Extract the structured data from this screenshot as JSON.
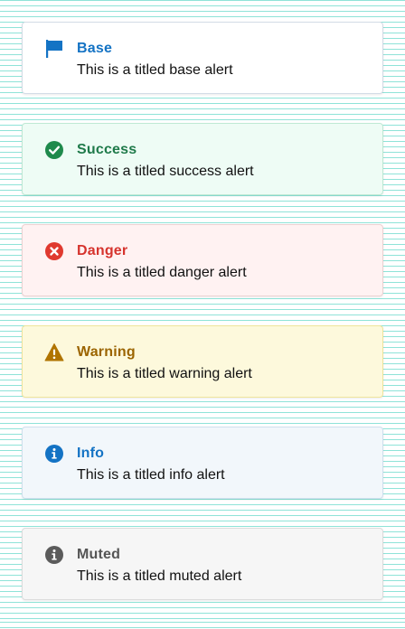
{
  "alerts": [
    {
      "variant": "base",
      "icon": "flag-icon",
      "title": "Base",
      "message": "This is a titled base alert",
      "color": "#1473c4"
    },
    {
      "variant": "success",
      "icon": "check-circle-icon",
      "title": "Success",
      "message": "This is a titled success alert",
      "color": "#1f8a4c"
    },
    {
      "variant": "danger",
      "icon": "x-circle-icon",
      "title": "Danger",
      "message": "This is a titled danger alert",
      "color": "#e0392f"
    },
    {
      "variant": "warning",
      "icon": "warning-triangle-icon",
      "title": "Warning",
      "message": "This is a titled warning alert",
      "color": "#b07400"
    },
    {
      "variant": "info",
      "icon": "info-circle-icon",
      "title": "Info",
      "message": "This is a titled info alert",
      "color": "#1473c4"
    },
    {
      "variant": "muted",
      "icon": "info-circle-icon",
      "title": "Muted",
      "message": "This is a titled muted alert",
      "color": "#5b5b5b"
    }
  ]
}
